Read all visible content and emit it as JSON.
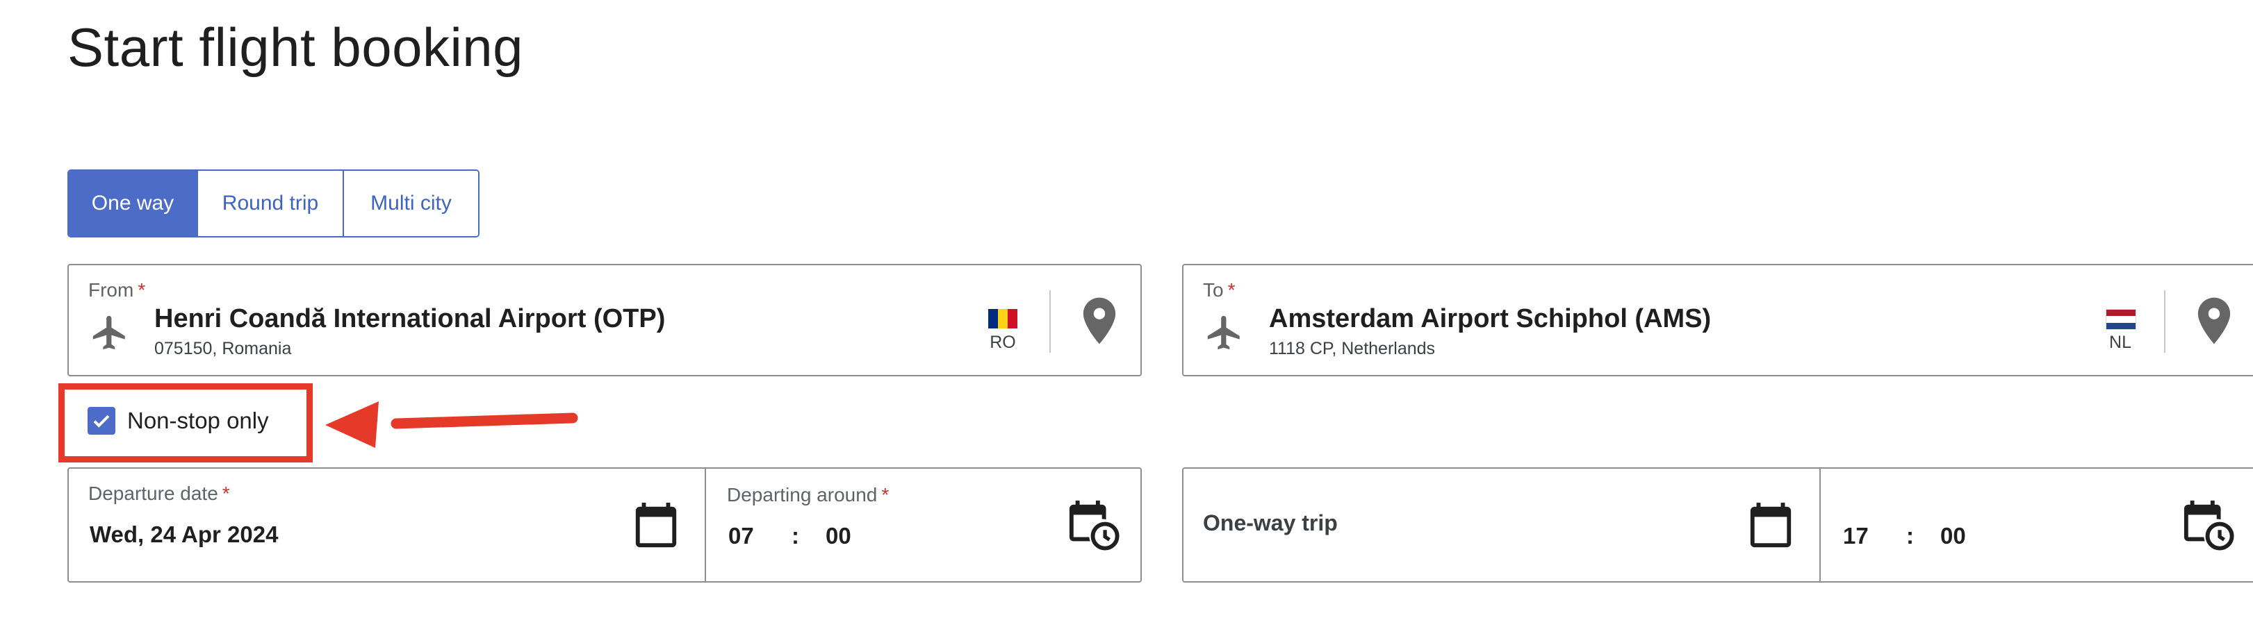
{
  "page": {
    "title": "Start flight booking"
  },
  "trip_type": {
    "options": [
      "One way",
      "Round trip",
      "Multi city"
    ],
    "selected": "One way"
  },
  "from": {
    "label": "From",
    "required_mark": "*",
    "airport": "Henri Coandă International Airport (OTP)",
    "address": "075150, Romania",
    "country_code": "RO",
    "flag_colors": [
      "#002B7F",
      "#FCD116",
      "#CE1126"
    ]
  },
  "to": {
    "label": "To",
    "required_mark": "*",
    "airport": "Amsterdam Airport Schiphol (AMS)",
    "address": "1118 CP, Netherlands",
    "country_code": "NL",
    "flag_colors": [
      "#AE1C28",
      "#FFFFFF",
      "#21468B"
    ]
  },
  "nonstop": {
    "label": "Non-stop only",
    "checked": true
  },
  "departure": {
    "date_label": "Departure date",
    "date_value": "Wed, 24 Apr 2024",
    "time_label": "Departing around",
    "hour": "07",
    "minute": "00",
    "required_mark": "*"
  },
  "return": {
    "label": "One-way trip",
    "hour": "17",
    "minute": "00"
  },
  "time_separator": ":",
  "icons": {
    "from_airport": "airplane-icon",
    "to_airport": "airplane-icon",
    "location": "map-pin-icon",
    "calendar": "calendar-icon",
    "time": "calendar-clock-icon",
    "checkbox": "checkmark-icon"
  },
  "colors": {
    "accent": "#4d6cc7",
    "required": "#d32f2f",
    "annotation": "#e53a2a",
    "icon": "#666666"
  }
}
